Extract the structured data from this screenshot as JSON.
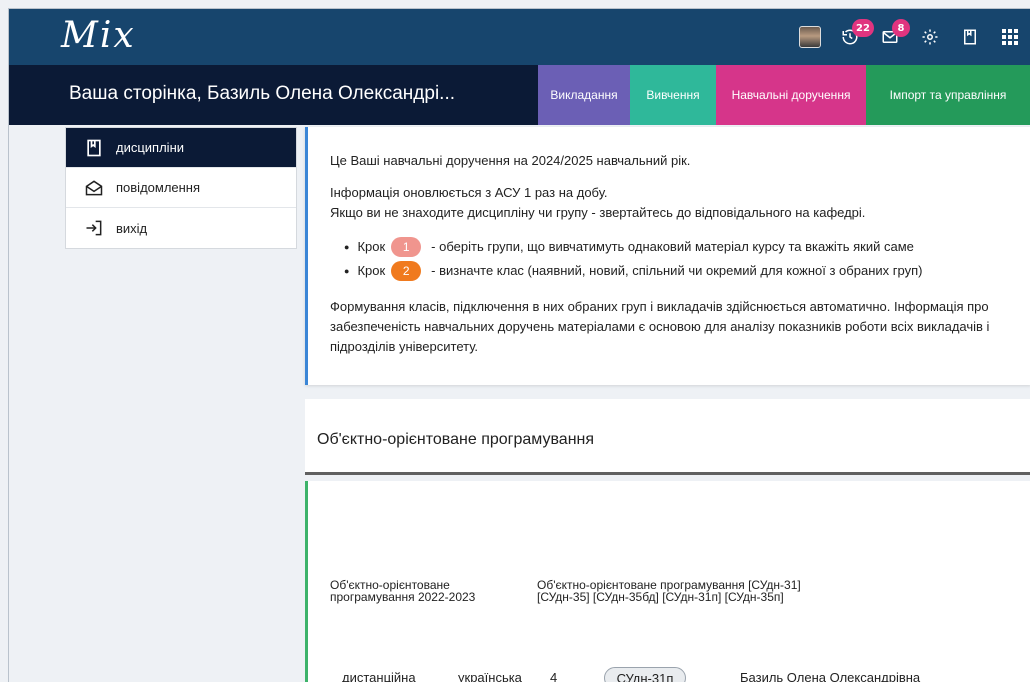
{
  "app": {
    "logo": "Mix"
  },
  "topbar": {
    "history_badge": "22",
    "mail_badge": "8",
    "icons": [
      "avatar",
      "history-icon",
      "mail-icon",
      "gear-icon",
      "bookmark-icon",
      "apps-grid-icon"
    ]
  },
  "title": "Ваша сторінка, Базиль Олена Олександрі...",
  "tabs": [
    {
      "label": "Викладання",
      "color": "#6b5fb5"
    },
    {
      "label": "Вивчення",
      "color": "#2fb89a"
    },
    {
      "label": "Навчальні доручення",
      "color": "#d6358a"
    },
    {
      "label": "Імпорт та управління",
      "color": "#249a5a"
    }
  ],
  "sidebar": {
    "items": [
      {
        "label": "дисципліни",
        "icon": "book-icon",
        "active": true
      },
      {
        "label": "повідомлення",
        "icon": "envelope-icon",
        "active": false
      },
      {
        "label": "вихід",
        "icon": "logout-icon",
        "active": false
      }
    ]
  },
  "info": {
    "line1": "Це Ваші навчальні доручення на 2024/2025 навчальний рік.",
    "line2": "Інформація оновлюється з АСУ 1 раз на добу.",
    "line3": "Якщо ви не знаходите дисципліну чи групу - звертайтесь до відповідального на кафедрі.",
    "step_label": "Крок",
    "step1_num": "1",
    "step1_text": "- оберіть групи, що вивчатимуть однаковий матеріал курсу та вкажіть який саме",
    "step1_color": "#f0958e",
    "step2_num": "2",
    "step2_text": "- визначте клас (наявний, новий, спільний чи окремий для кожної з обраних груп)",
    "step2_color": "#f07a1e",
    "footer": "Формування класів, підключення в них обраних груп і викладачів здійснюється автоматично. Інформація про забезпеченість навчальних доручень матеріалами є основою для аналізу показників роботи всіх викладачів і підрозділів університету."
  },
  "course": {
    "title": "Об'єктно-орієнтоване програмування"
  },
  "group": {
    "name_line1": "Об'єктно-орієнтоване",
    "name_line2": "програмування 2022-2023",
    "full_line1": "Об'єктно-орієнтоване програмування [СУдн-31]",
    "full_line2": "[СУдн-35] [СУдн-35бд] [СУдн-31п] [СУдн-35п]",
    "form": "дистанційна",
    "language": "українська",
    "course_num": "4",
    "group_code": "СУдн-31п",
    "teacher": "Базиль Олена Олександрівна"
  }
}
